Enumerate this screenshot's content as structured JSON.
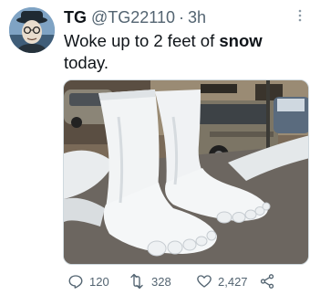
{
  "tweet": {
    "display_name": "TG",
    "handle": "@TG22110",
    "separator": "·",
    "time": "3h",
    "text_before": "Woke up to 2 feet of ",
    "text_bold": "snow",
    "text_after": " today.",
    "media_description": "Snow sculpture of two giant bare feet on a city sidewalk",
    "counts": {
      "replies": "120",
      "retweets": "328",
      "likes": "2,427"
    }
  },
  "colors": {
    "text": "#0f1419",
    "secondary": "#536471",
    "border": "#cfd9de"
  },
  "icons": [
    "more-icon",
    "reply-icon",
    "retweet-icon",
    "like-icon",
    "share-icon"
  ]
}
